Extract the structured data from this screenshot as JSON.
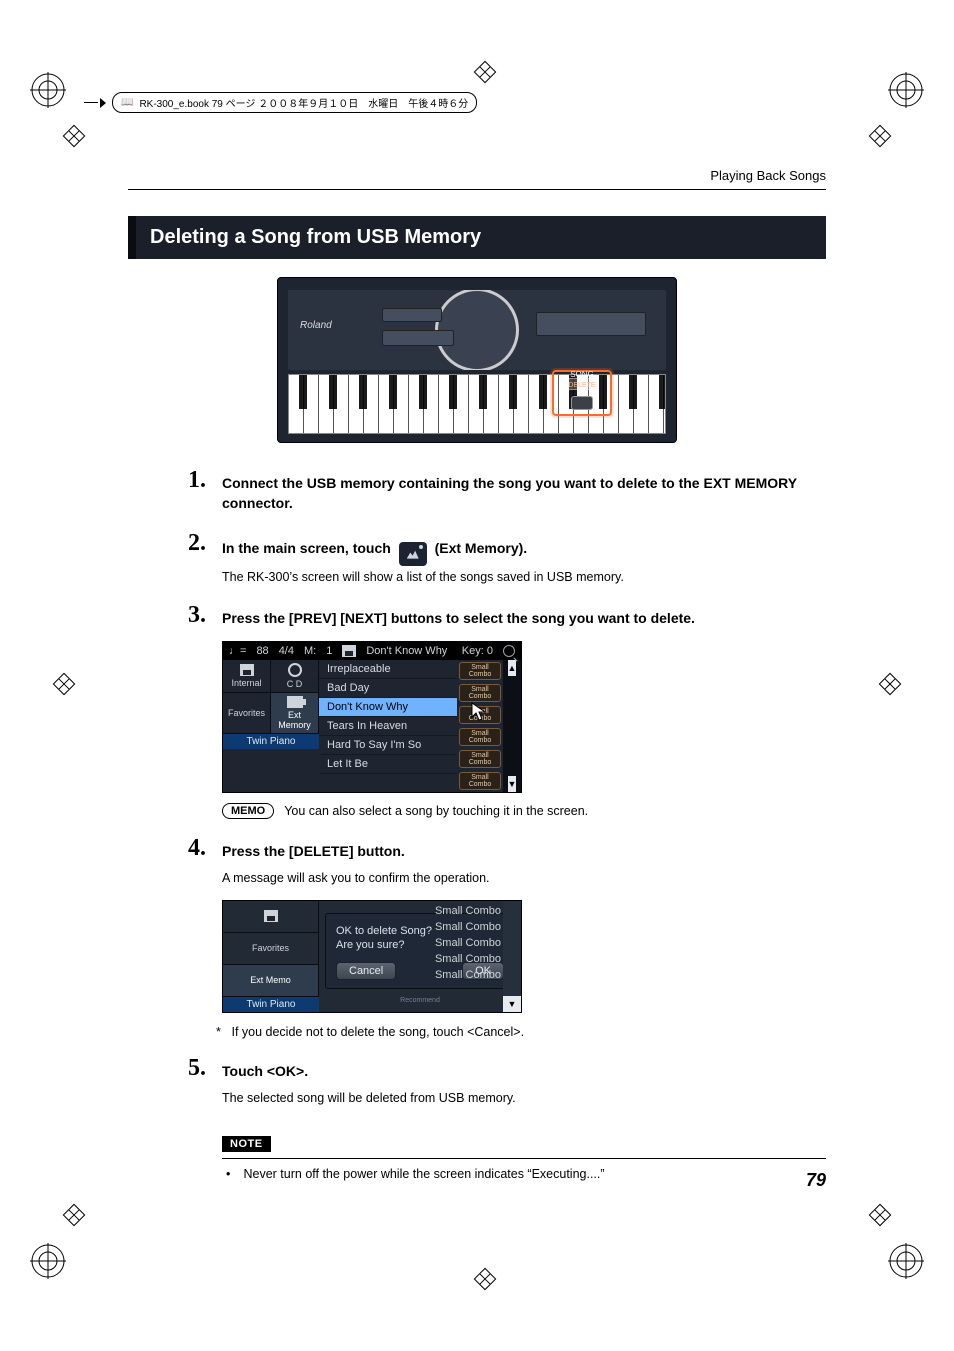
{
  "header": {
    "breadcrumb": "RK-300_e.book  79 ページ  ２００８年９月１０日　水曜日　午後４時６分"
  },
  "running_head": "Playing Back Songs",
  "section_title": "Deleting a Song from USB Memory",
  "hero": {
    "brand": "Roland",
    "highlight_label": "SONG",
    "highlight_sublabel": "DELETE"
  },
  "steps": [
    {
      "num": "1.",
      "head": "Connect the USB memory containing the song you want to delete to the EXT MEMORY connector."
    },
    {
      "num": "2.",
      "head_pre": "In the main screen, touch ",
      "head_post": " (Ext Memory).",
      "body": "The RK-300’s screen will show a list of the songs saved in USB memory."
    },
    {
      "num": "3.",
      "head": "Press the [PREV] [NEXT] buttons to select the song you want to delete.",
      "memo": "You can also select a song by touching it in the screen."
    },
    {
      "num": "4.",
      "head": "Press the [DELETE] button.",
      "body": "A message will ask you to confirm the operation.",
      "footnote": "If you decide not to delete the song, touch <Cancel>."
    },
    {
      "num": "5.",
      "head": "Touch <OK>.",
      "body": "The selected song will be deleted from USB memory."
    }
  ],
  "songlist": {
    "tempo_label": "♩=",
    "tempo_value": "88",
    "time_sig": "4/4",
    "measure_label": "M:",
    "measure_value": "1",
    "now_playing_prefix": "",
    "now_playing": "Don't Know Why",
    "key_label": "Key:",
    "key_value": "0",
    "left_labels": {
      "internal": "Internal",
      "cd": "C D",
      "favorites": "Favorites",
      "ext": "Ext Memory",
      "twin": "Twin Piano"
    },
    "tracks": [
      "Irreplaceable",
      "Bad Day",
      "Don't Know Why",
      "Tears In Heaven",
      "Hard To Say I'm So",
      "Let It Be"
    ],
    "badge": "Small Combo",
    "selected_track": "Don't Know Why"
  },
  "confirm": {
    "left_labels": {
      "favorites": "Favorites",
      "ext": "Ext Memo",
      "twin": "Twin Piano"
    },
    "msg_line1": "OK to delete Song?",
    "msg_line2": "Are you sure?",
    "btn_cancel": "Cancel",
    "btn_ok": "OK",
    "badge": "Small Combo",
    "footer_hint": "Recommend"
  },
  "memo_label": "MEMO",
  "note": {
    "label": "NOTE",
    "items": [
      "Never turn off the power while the screen indicates “Executing....”"
    ]
  },
  "page_number": "79"
}
